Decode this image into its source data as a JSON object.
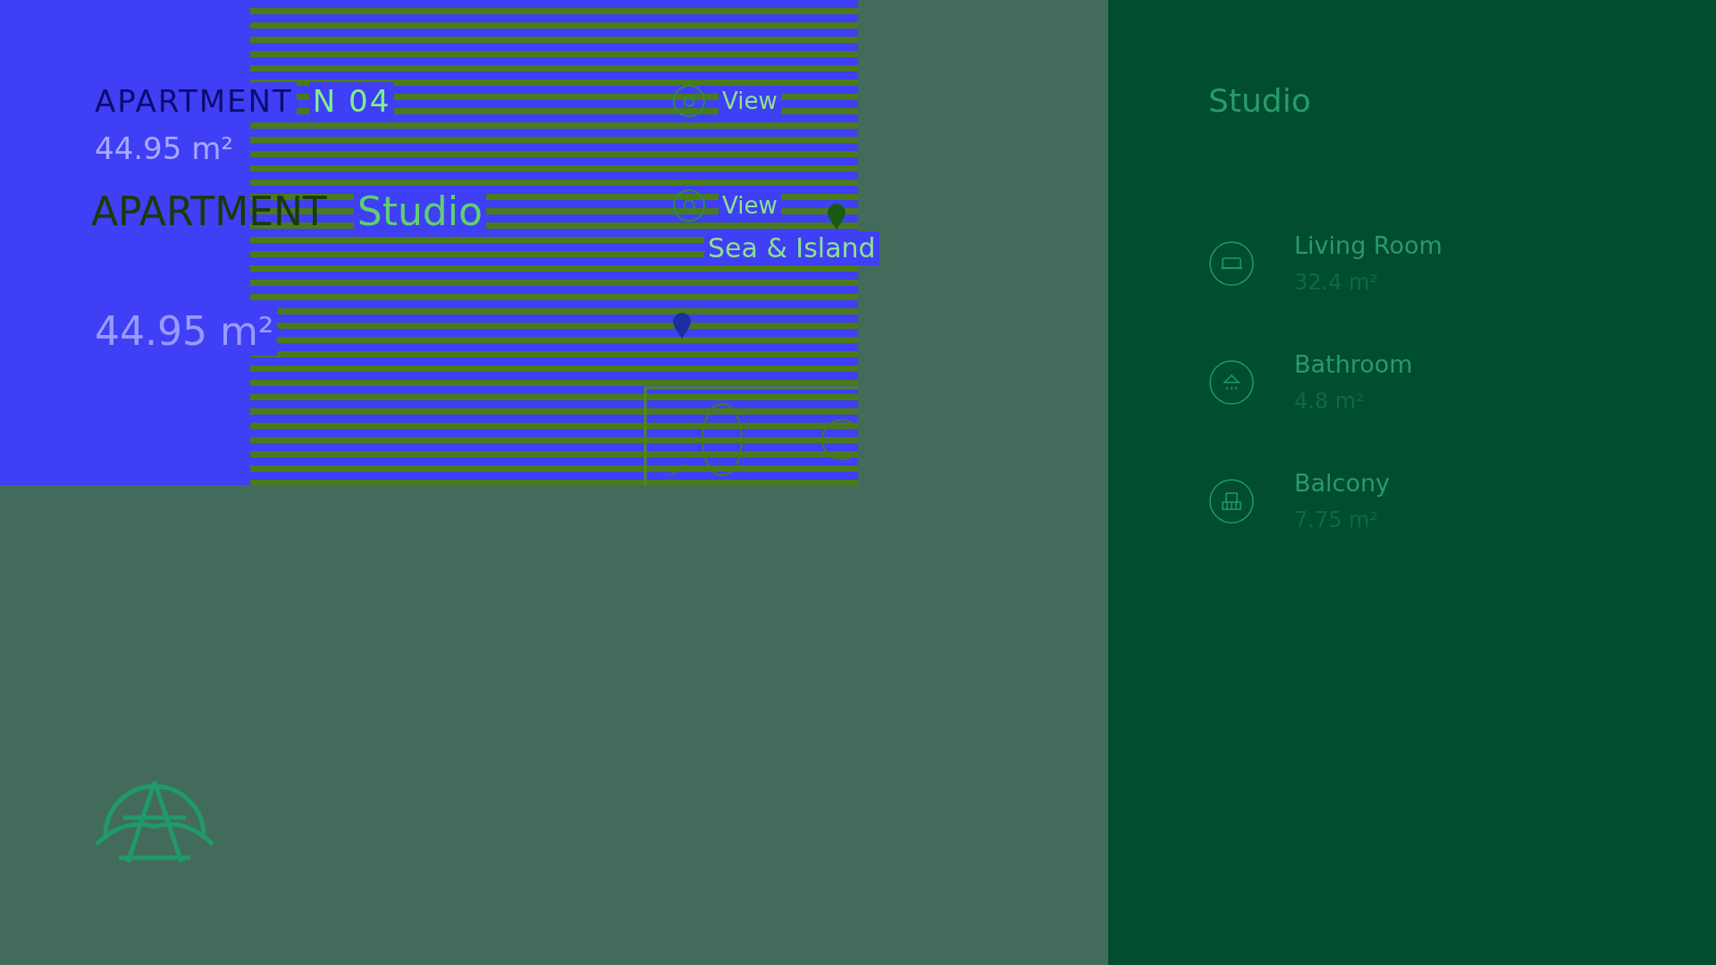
{
  "header": {
    "title": "APARTMENT",
    "number": "N 04",
    "area": "44.95 m²",
    "view_label": "View"
  },
  "ghost": {
    "title": "APARTMENT",
    "type": "Studio",
    "area": "44.95 m²",
    "view_label": "View",
    "view_value": "Sea & Island"
  },
  "panel": {
    "title": "Studio",
    "rooms": [
      {
        "kind": "sofa",
        "name": "Living Room",
        "area": "32.4 m²"
      },
      {
        "kind": "shower",
        "name": "Bathroom",
        "area": "4.8 m²"
      },
      {
        "kind": "balcony",
        "name": "Balcony",
        "area": "7.75 m²"
      }
    ]
  }
}
